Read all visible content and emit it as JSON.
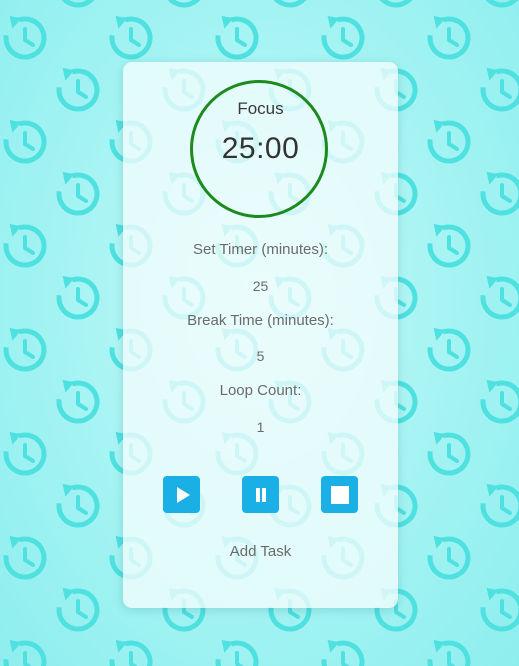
{
  "timer": {
    "mode_label": "Focus",
    "time_display": "25:00",
    "ring_color": "#1d8a1d"
  },
  "settings": {
    "set_timer_label": "Set Timer (minutes):",
    "set_timer_value": "25",
    "break_time_label": "Break Time (minutes):",
    "break_time_value": "5",
    "loop_count_label": "Loop Count:",
    "loop_count_value": "1"
  },
  "controls": {
    "accent_color": "#1ab0e6",
    "buttons": [
      {
        "name": "start-button",
        "icon": "play-icon"
      },
      {
        "name": "pause-button",
        "icon": "pause-icon"
      },
      {
        "name": "stop-button",
        "icon": "stop-icon"
      }
    ]
  },
  "add_task_label": "Add Task",
  "background": {
    "colors": [
      "#c9fafa",
      "#8eeeee"
    ],
    "pattern_icon": "restart-clock-icon"
  }
}
